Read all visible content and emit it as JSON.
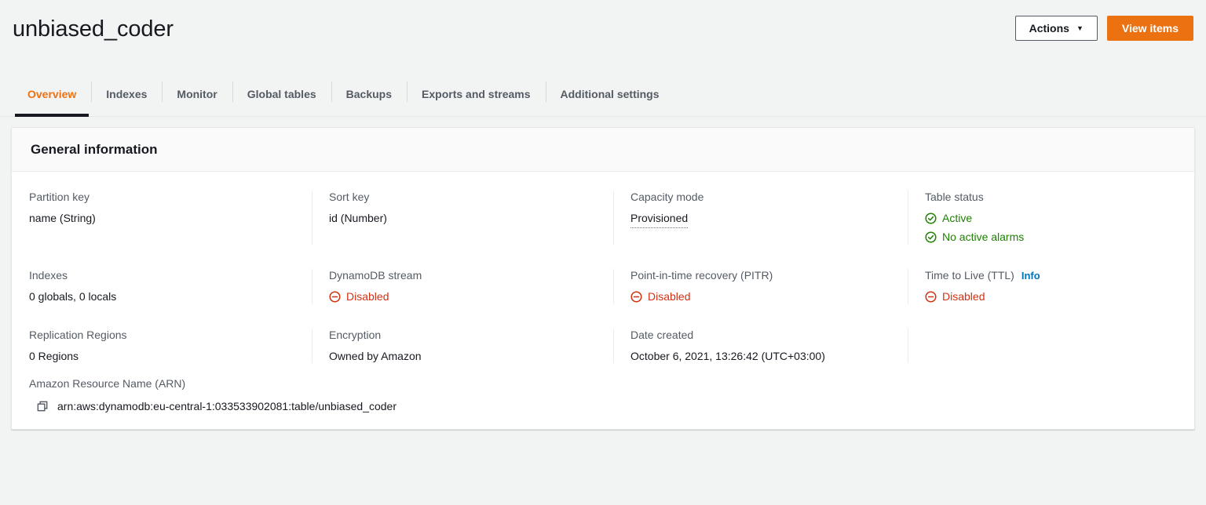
{
  "header": {
    "title": "unbiased_coder",
    "actions_label": "Actions",
    "actions_caret": "▼",
    "view_items_label": "View items"
  },
  "tabs": [
    {
      "label": "Overview",
      "active": true
    },
    {
      "label": "Indexes",
      "active": false
    },
    {
      "label": "Monitor",
      "active": false
    },
    {
      "label": "Global tables",
      "active": false
    },
    {
      "label": "Backups",
      "active": false
    },
    {
      "label": "Exports and streams",
      "active": false
    },
    {
      "label": "Additional settings",
      "active": false
    }
  ],
  "general_information": {
    "section_title": "General information",
    "partition_key": {
      "label": "Partition key",
      "value": "name (String)"
    },
    "sort_key": {
      "label": "Sort key",
      "value": "id (Number)"
    },
    "capacity_mode": {
      "label": "Capacity mode",
      "value": "Provisioned"
    },
    "table_status": {
      "label": "Table status",
      "status_1": "Active",
      "status_2": "No active alarms"
    },
    "indexes": {
      "label": "Indexes",
      "value": "0 globals, 0 locals"
    },
    "dynamodb_stream": {
      "label": "DynamoDB stream",
      "value": "Disabled"
    },
    "pitr": {
      "label": "Point-in-time recovery (PITR)",
      "value": "Disabled"
    },
    "ttl": {
      "label": "Time to Live (TTL)",
      "info_link": "Info",
      "value": "Disabled"
    },
    "replication_regions": {
      "label": "Replication Regions",
      "value": "0 Regions"
    },
    "encryption": {
      "label": "Encryption",
      "value": "Owned by Amazon"
    },
    "date_created": {
      "label": "Date created",
      "value": "October 6, 2021, 13:26:42 (UTC+03:00)"
    },
    "arn": {
      "label": "Amazon Resource Name (ARN)",
      "value": "arn:aws:dynamodb:eu-central-1:033533902081:table/unbiased_coder"
    }
  },
  "colors": {
    "accent_orange": "#ec7211",
    "link_blue": "#0073bb",
    "status_green": "#1d8102",
    "status_red": "#d13212",
    "page_background": "#f2f3f3",
    "text_primary": "#16191f",
    "text_secondary": "#545b64"
  }
}
